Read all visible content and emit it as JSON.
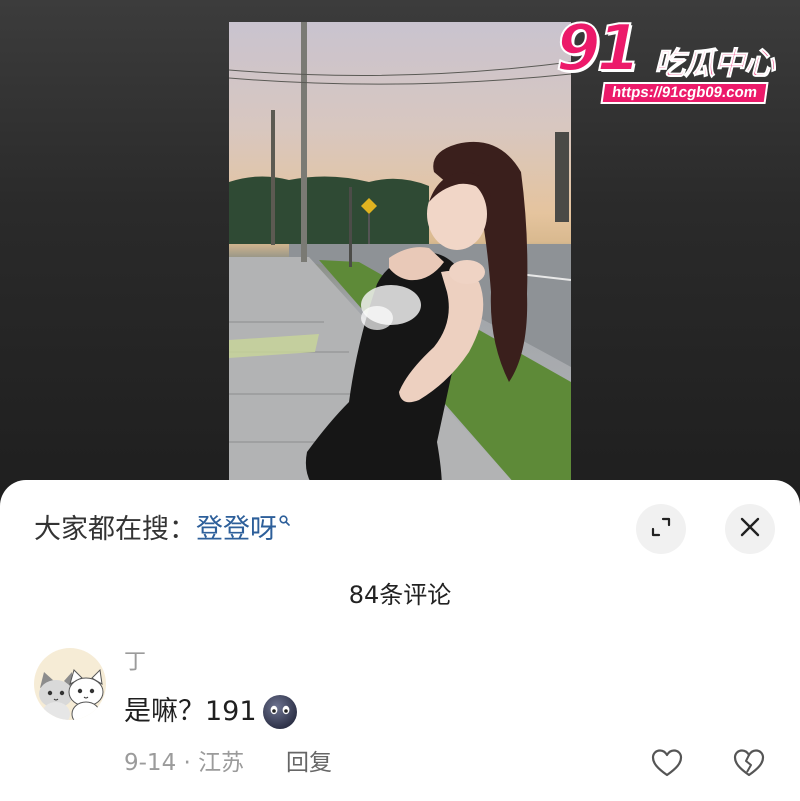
{
  "watermark": {
    "number": "91",
    "name": "吃瓜中心",
    "url": "https://91cgb09.com"
  },
  "sheet": {
    "search_prefix": "大家都在搜：",
    "search_term": "登登呀",
    "comment_count": "84条评论"
  },
  "comment": {
    "username": "丁",
    "text": "是嘛？191",
    "date_location": "9-14 · 江苏",
    "reply_label": "回复"
  },
  "icons": {
    "search": "search-icon",
    "expand": "expand-icon",
    "close": "close-icon",
    "like": "heart-icon",
    "dislike": "broken-heart-icon",
    "emoji": "shadow-face-emoji-icon"
  },
  "colors": {
    "brand": "#ec1a6a",
    "link": "#2d5f9a",
    "muted_text": "#9b9b9b",
    "sheet_bg": "#ffffff"
  }
}
